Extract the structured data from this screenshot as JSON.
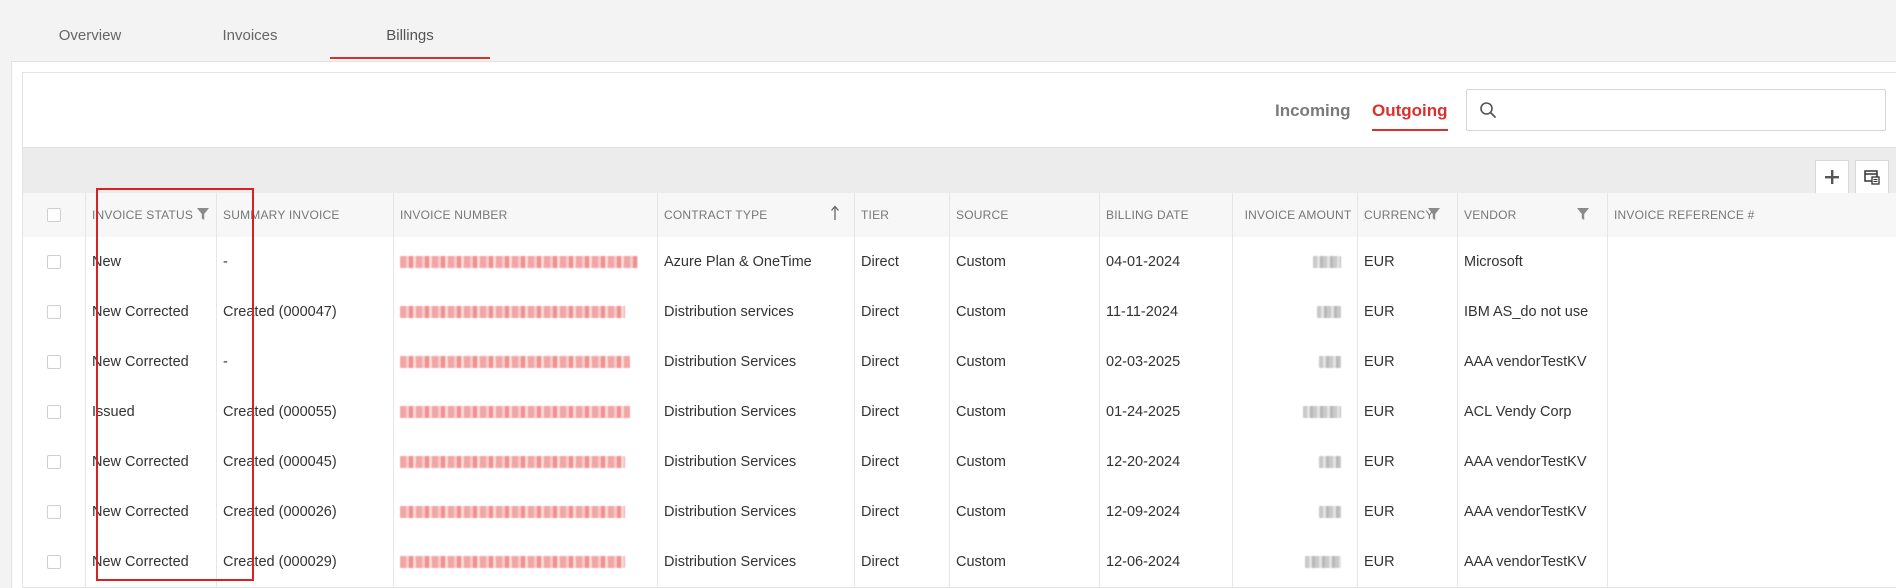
{
  "top_tabs": [
    {
      "label": "Overview",
      "active": false
    },
    {
      "label": "Invoices",
      "active": false
    },
    {
      "label": "Billings",
      "active": true
    }
  ],
  "direction_tabs": {
    "incoming": "Incoming",
    "outgoing": "Outgoing",
    "active": "Outgoing"
  },
  "search": {
    "placeholder": "",
    "value": "",
    "icon": "search-icon"
  },
  "toolbar": {
    "add_icon": "plus-icon",
    "columns_icon": "column-chooser-icon"
  },
  "colors": {
    "accent": "#d9322e",
    "highlight": "#d9221f"
  },
  "table": {
    "columns": [
      {
        "key": "select",
        "label": ""
      },
      {
        "key": "invoice_status",
        "label": "INVOICE STATUS",
        "filter": true
      },
      {
        "key": "summary_invoice",
        "label": "SUMMARY INVOICE"
      },
      {
        "key": "invoice_number",
        "label": "INVOICE NUMBER"
      },
      {
        "key": "contract_type",
        "label": "CONTRACT TYPE",
        "sort": "ascending"
      },
      {
        "key": "tier",
        "label": "TIER"
      },
      {
        "key": "source",
        "label": "SOURCE"
      },
      {
        "key": "billing_date",
        "label": "BILLING DATE"
      },
      {
        "key": "invoice_amount",
        "label": "INVOICE AMOUNT"
      },
      {
        "key": "currency",
        "label": "CURRENCY",
        "filter": true
      },
      {
        "key": "vendor",
        "label": "VENDOR",
        "filter": true
      },
      {
        "key": "invoice_reference",
        "label": "INVOICE REFERENCE #"
      }
    ],
    "rows": [
      {
        "invoice_status": "New",
        "summary_invoice": "-",
        "contract_type": "Azure Plan & OneTime",
        "tier": "Direct",
        "source": "Custom",
        "billing_date": "04-01-2024",
        "currency": "EUR",
        "vendor": "Microsoft",
        "invoice_reference": ""
      },
      {
        "invoice_status": "New Corrected",
        "summary_invoice": "Created (000047)",
        "contract_type": "Distribution services",
        "tier": "Direct",
        "source": "Custom",
        "billing_date": "11-11-2024",
        "currency": "EUR",
        "vendor": "IBM AS_do not use",
        "invoice_reference": ""
      },
      {
        "invoice_status": "New Corrected",
        "summary_invoice": "-",
        "contract_type": "Distribution Services",
        "tier": "Direct",
        "source": "Custom",
        "billing_date": "02-03-2025",
        "currency": "EUR",
        "vendor": "AAA vendorTestKV",
        "invoice_reference": ""
      },
      {
        "invoice_status": "Issued",
        "summary_invoice": "Created (000055)",
        "contract_type": "Distribution Services",
        "tier": "Direct",
        "source": "Custom",
        "billing_date": "01-24-2025",
        "currency": "EUR",
        "vendor": "ACL Vendy Corp",
        "invoice_reference": ""
      },
      {
        "invoice_status": "New Corrected",
        "summary_invoice": "Created (000045)",
        "contract_type": "Distribution Services",
        "tier": "Direct",
        "source": "Custom",
        "billing_date": "12-20-2024",
        "currency": "EUR",
        "vendor": "AAA vendorTestKV",
        "invoice_reference": ""
      },
      {
        "invoice_status": "New Corrected",
        "summary_invoice": "Created (000026)",
        "contract_type": "Distribution Services",
        "tier": "Direct",
        "source": "Custom",
        "billing_date": "12-09-2024",
        "currency": "EUR",
        "vendor": "AAA vendorTestKV",
        "invoice_reference": ""
      },
      {
        "invoice_status": "New Corrected",
        "summary_invoice": "Created (000029)",
        "contract_type": "Distribution Services",
        "tier": "Direct",
        "source": "Custom",
        "billing_date": "12-06-2024",
        "currency": "EUR",
        "vendor": "AAA vendorTestKV",
        "invoice_reference": ""
      }
    ]
  }
}
